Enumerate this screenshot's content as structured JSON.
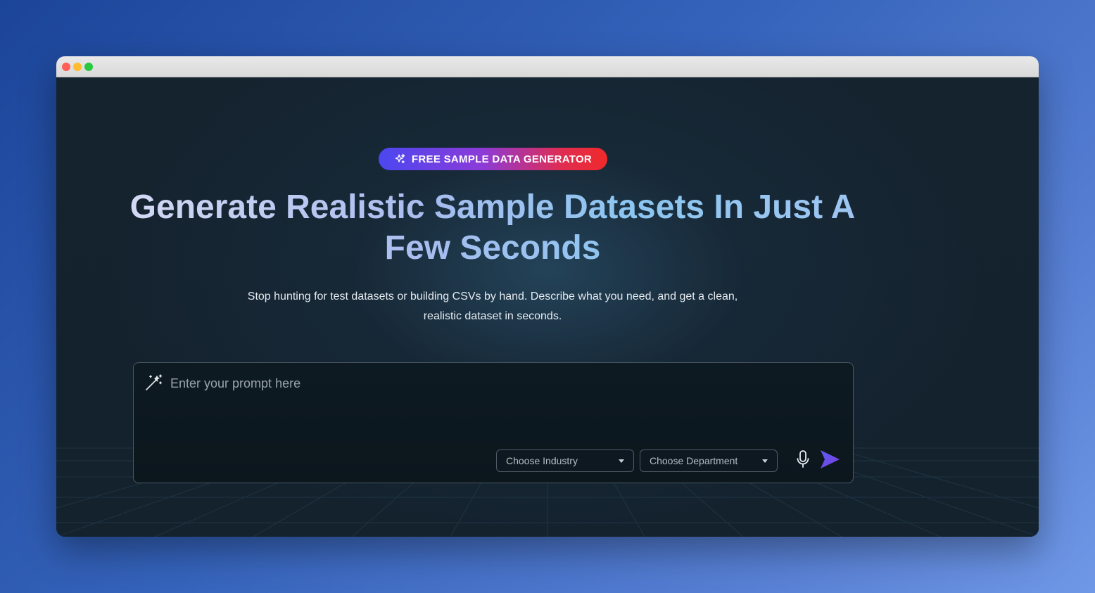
{
  "badge": {
    "label": "FREE SAMPLE DATA GENERATOR",
    "icon": "sparkles-icon"
  },
  "hero": {
    "title": "Generate Realistic Sample Datasets In Just A Few Seconds",
    "subtitle": "Stop hunting for test datasets or building CSVs by hand. Describe what you need, and get a clean, realistic dataset in seconds."
  },
  "prompt": {
    "placeholder": "Enter your prompt here",
    "value": "",
    "icon": "magic-wand-icon",
    "industry_select": "Choose Industry",
    "department_select": "Choose Department",
    "mic_icon": "microphone-icon",
    "send_icon": "send-icon"
  },
  "colors": {
    "badge_start": "#4b47f0",
    "badge_end": "#f02a2a",
    "send_accent": "#6d4cf0"
  }
}
